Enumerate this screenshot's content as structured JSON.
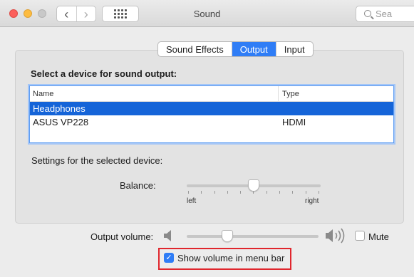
{
  "window": {
    "title": "Sound",
    "search_placeholder": "Sea"
  },
  "tabs": [
    {
      "label": "Sound Effects",
      "active": false
    },
    {
      "label": "Output",
      "active": true
    },
    {
      "label": "Input",
      "active": false
    }
  ],
  "output": {
    "heading": "Select a device for sound output:",
    "columns": {
      "name": "Name",
      "type": "Type"
    },
    "devices": [
      {
        "name": "Headphones",
        "type": "",
        "selected": true
      },
      {
        "name": "ASUS VP228",
        "type": "HDMI",
        "selected": false
      }
    ],
    "settings_heading": "Settings for the selected device:",
    "balance": {
      "label": "Balance:",
      "left_label": "left",
      "right_label": "right",
      "value": 0.5
    }
  },
  "volume": {
    "label": "Output volume:",
    "value": 0.31,
    "mute_label": "Mute",
    "muted": false
  },
  "show_in_menu_bar": {
    "label": "Show volume in menu bar",
    "checked": true
  },
  "colors": {
    "accent": "#2f7df6",
    "selection": "#1564d8",
    "highlight": "#e0262d"
  }
}
